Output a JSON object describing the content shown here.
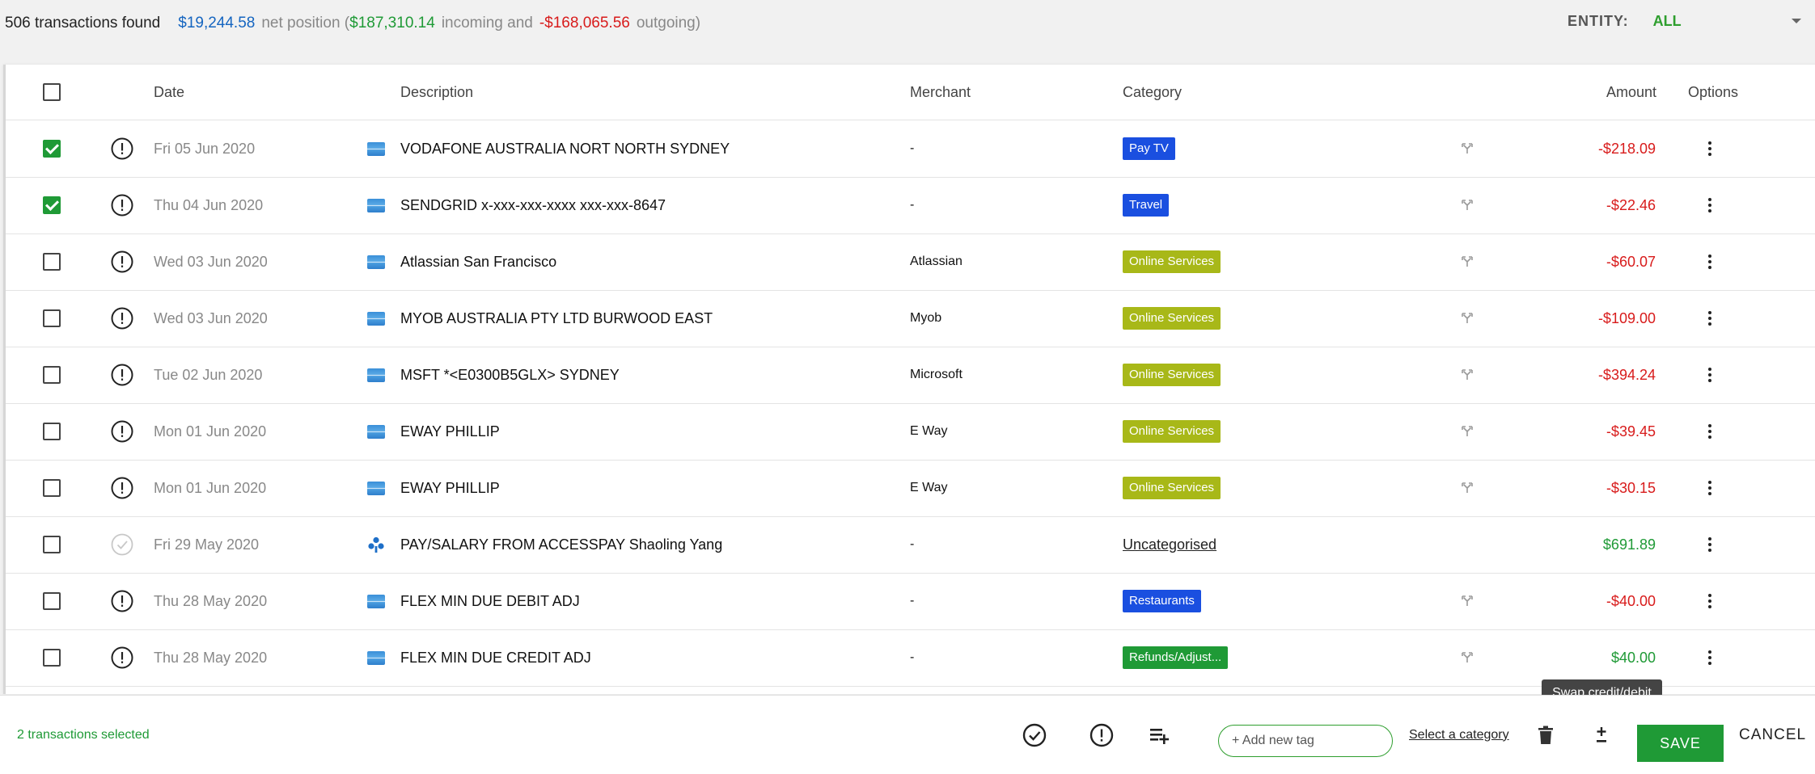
{
  "summary": {
    "count_text": "506 transactions found",
    "net": "$19,244.58",
    "net_label": "net position (",
    "incoming": "$187,310.14",
    "incoming_label": "incoming and",
    "outgoing": "-$168,065.56",
    "outgoing_label": "outgoing)"
  },
  "entity": {
    "label": "ENTITY:",
    "value": "ALL"
  },
  "table": {
    "headers": {
      "date": "Date",
      "description": "Description",
      "merchant": "Merchant",
      "category": "Category",
      "amount": "Amount",
      "options": "Options"
    },
    "rows": [
      {
        "checked": true,
        "status": "alert",
        "date": "Fri 05 Jun 2020",
        "bank": "card",
        "description": "VODAFONE AUSTRALIA NORT NORTH SYDNEY",
        "merchant": "-",
        "category": "Pay TV",
        "category_color": "#1a4fe0",
        "split": true,
        "amount": "-$218.09",
        "sign": "neg"
      },
      {
        "checked": true,
        "status": "alert",
        "date": "Thu 04 Jun 2020",
        "bank": "card",
        "description": "SENDGRID x-xxx-xxx-xxxx xxx-xxx-8647",
        "merchant": "-",
        "category": "Travel",
        "category_color": "#1a4fe0",
        "split": true,
        "amount": "-$22.46",
        "sign": "neg"
      },
      {
        "checked": false,
        "status": "alert",
        "date": "Wed 03 Jun 2020",
        "bank": "card",
        "description": "Atlassian San Francisco",
        "merchant": "Atlassian",
        "category": "Online Services",
        "category_color": "#a8b818",
        "split": true,
        "amount": "-$60.07",
        "sign": "neg"
      },
      {
        "checked": false,
        "status": "alert",
        "date": "Wed 03 Jun 2020",
        "bank": "card",
        "description": "MYOB AUSTRALIA PTY LTD BURWOOD EAST",
        "merchant": "Myob",
        "category": "Online Services",
        "category_color": "#a8b818",
        "split": true,
        "amount": "-$109.00",
        "sign": "neg"
      },
      {
        "checked": false,
        "status": "alert",
        "date": "Tue 02 Jun 2020",
        "bank": "card",
        "description": "MSFT *<E0300B5GLX> SYDNEY",
        "merchant": "Microsoft",
        "category": "Online Services",
        "category_color": "#a8b818",
        "split": true,
        "amount": "-$394.24",
        "sign": "neg"
      },
      {
        "checked": false,
        "status": "alert",
        "date": "Mon 01 Jun 2020",
        "bank": "card",
        "description": "EWAY PHILLIP",
        "merchant": "E Way",
        "category": "Online Services",
        "category_color": "#a8b818",
        "split": true,
        "amount": "-$39.45",
        "sign": "neg"
      },
      {
        "checked": false,
        "status": "alert",
        "date": "Mon 01 Jun 2020",
        "bank": "card",
        "description": "EWAY PHILLIP",
        "merchant": "E Way",
        "category": "Online Services",
        "category_color": "#a8b818",
        "split": true,
        "amount": "-$30.15",
        "sign": "neg"
      },
      {
        "checked": false,
        "status": "done",
        "date": "Fri 29 May 2020",
        "bank": "bank",
        "description": "PAY/SALARY FROM ACCESSPAY Shaoling Yang",
        "merchant": "-",
        "category": "Uncategorised",
        "category_color": "",
        "split": false,
        "amount": "$691.89",
        "sign": "pos"
      },
      {
        "checked": false,
        "status": "alert",
        "date": "Thu 28 May 2020",
        "bank": "card",
        "description": "FLEX MIN DUE DEBIT ADJ",
        "merchant": "-",
        "category": "Restaurants",
        "category_color": "#1a4fe0",
        "split": true,
        "amount": "-$40.00",
        "sign": "neg"
      },
      {
        "checked": false,
        "status": "alert",
        "date": "Thu 28 May 2020",
        "bank": "card",
        "description": "FLEX MIN DUE CREDIT ADJ",
        "merchant": "-",
        "category": "Refunds/Adjust...",
        "category_color": "#1f9a36",
        "split": true,
        "amount": "$40.00",
        "sign": "pos"
      }
    ]
  },
  "tooltip": "Swap credit/debit",
  "bottom": {
    "selected_text": "2 transactions selected",
    "tag_placeholder": "+ Add new tag",
    "select_category": "Select a category",
    "save": "SAVE",
    "cancel": "CANCEL"
  },
  "colors": {
    "accent": "#1f9a36",
    "negative": "#d81b1b",
    "net": "#1565c0"
  }
}
